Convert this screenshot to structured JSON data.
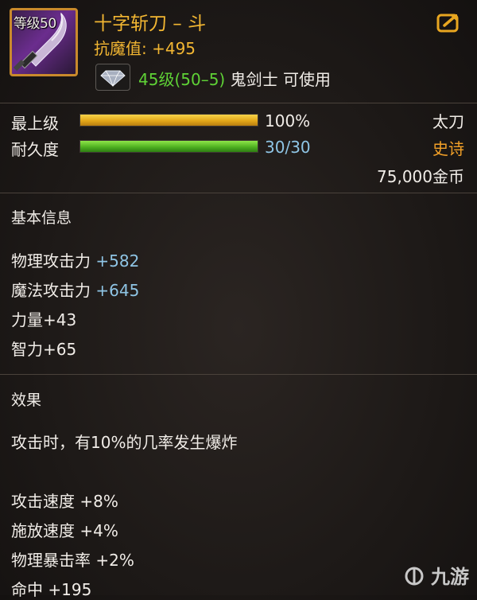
{
  "item": {
    "level_badge": "等级50",
    "name": "十字斩刀 – 斗",
    "stat": "抗魔值: +495",
    "requirement_level": "45级(50–5)",
    "requirement_class": "鬼剑士 可使用"
  },
  "status": {
    "grade_label": "最上级",
    "grade_value": "100%",
    "grade_fraction": 1.0,
    "grade_bar_color": "#e3a719",
    "durability_label": "耐久度",
    "durability_value": "30/30",
    "durability_fraction": 1.0,
    "durability_bar_color": "#4fb121",
    "weapon_type": "太刀",
    "rarity": "史诗",
    "rarity_color": "#f2a028",
    "price": "75,000金币"
  },
  "basic_info": {
    "title": "基本信息",
    "stats": [
      {
        "name": "物理攻击力 ",
        "value": "+582"
      },
      {
        "name": "魔法攻击力 ",
        "value": "+645"
      },
      {
        "name": "力量+43",
        "value": ""
      },
      {
        "name": "智力+65",
        "value": ""
      }
    ]
  },
  "effects": {
    "title": "效果",
    "description": "攻击时，有10%的几率发生爆炸",
    "bonuses": [
      "攻击速度 +8%",
      "施放速度 +4%",
      "物理暴击率 +2%",
      "命中 +195"
    ]
  },
  "watermark": "九游",
  "icons": [
    "weapon-icon",
    "share-icon",
    "gem-icon",
    "watermark-logo-icon"
  ]
}
